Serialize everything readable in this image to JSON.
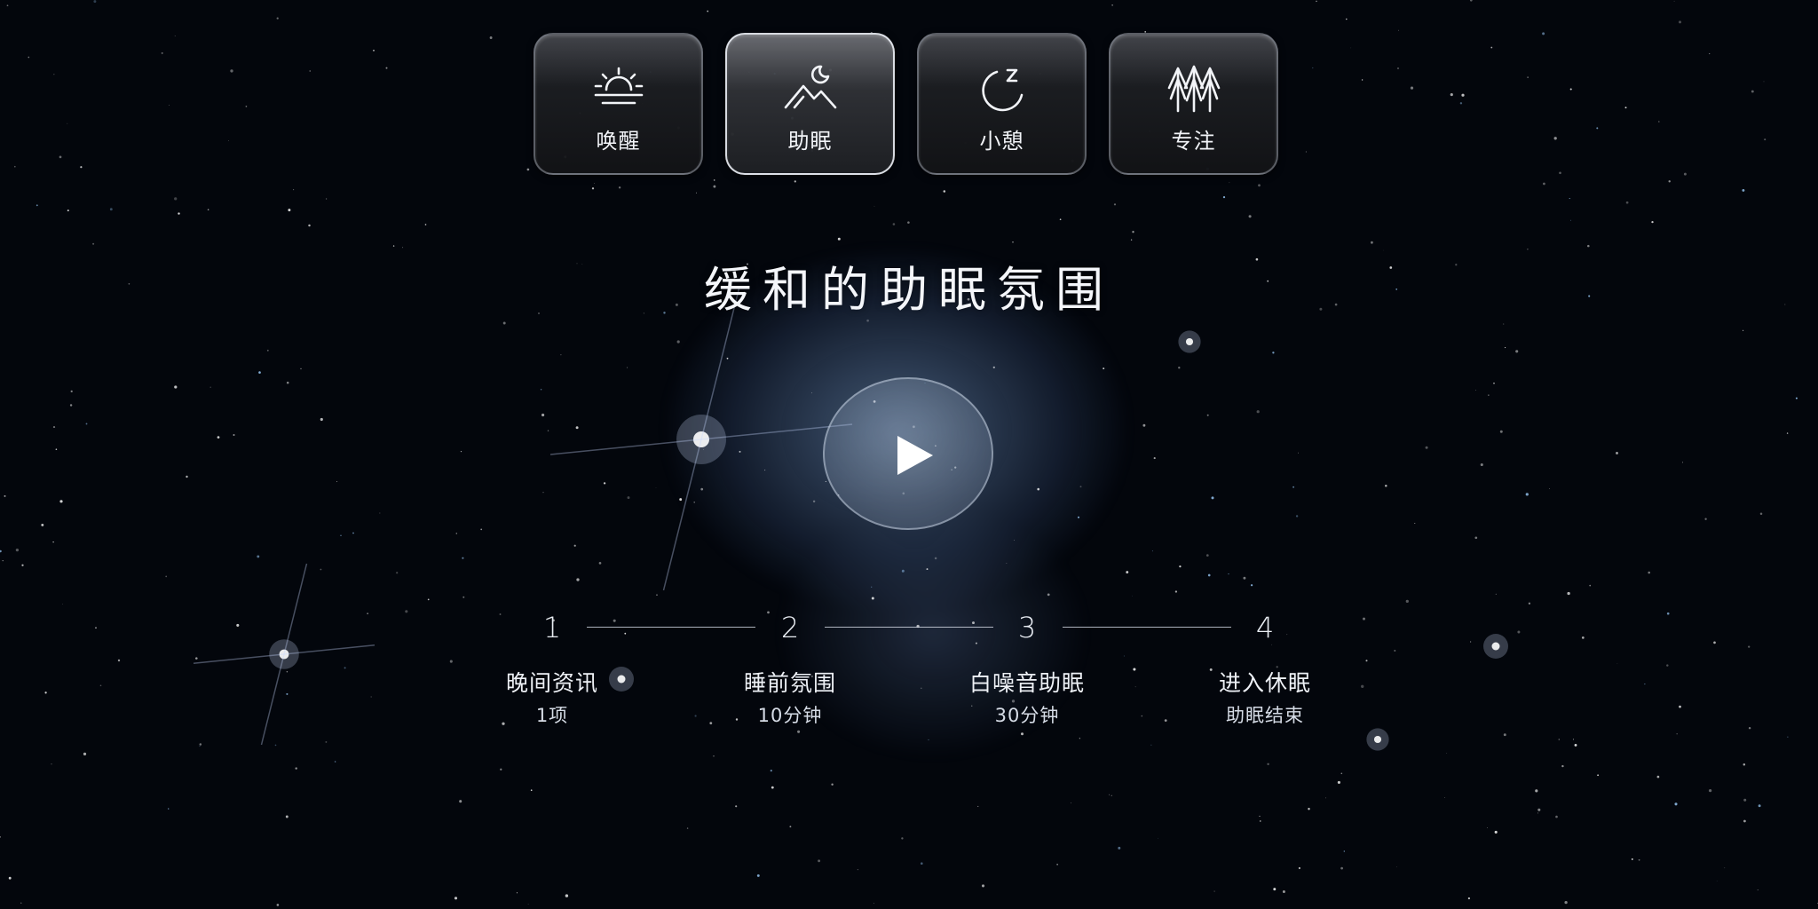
{
  "modes": [
    {
      "label": "唤醒",
      "icon": "sunrise-icon",
      "active": false
    },
    {
      "label": "助眠",
      "icon": "moon-mountain-icon",
      "active": true
    },
    {
      "label": "小憩",
      "icon": "nap-zz-icon",
      "active": false
    },
    {
      "label": "专注",
      "icon": "trees-icon",
      "active": false
    }
  ],
  "title": "缓和的助眠氛围",
  "play_button": {
    "icon": "play-icon"
  },
  "steps": [
    {
      "number": "1",
      "title": "晚间资讯",
      "subtitle": "1项"
    },
    {
      "number": "2",
      "title": "睡前氛围",
      "subtitle": "10分钟"
    },
    {
      "number": "3",
      "title": "白噪音助眠",
      "subtitle": "30分钟"
    },
    {
      "number": "4",
      "title": "进入休眠",
      "subtitle": "助眠结束"
    }
  ],
  "colors": {
    "background": "#03060c",
    "nebula": "#7899c8",
    "text": "#f4f6fa"
  }
}
